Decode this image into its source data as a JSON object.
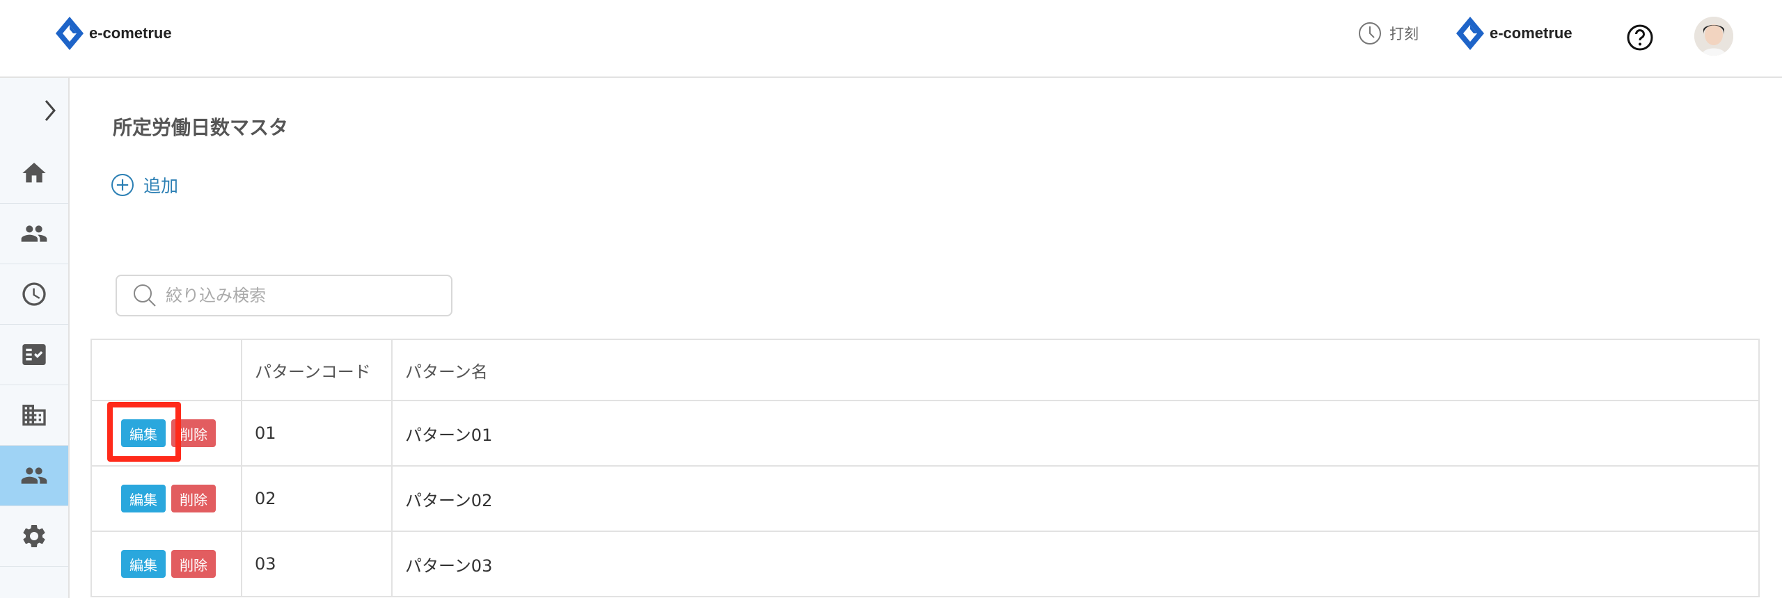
{
  "header": {
    "logo_text": "e-cometrue",
    "stamp_label": "打刻",
    "company_logo_text": "e-cometrue"
  },
  "sidebar": {
    "items": [
      {
        "icon": "home-icon"
      },
      {
        "icon": "people-icon"
      },
      {
        "icon": "clock-icon"
      },
      {
        "icon": "checklist-icon"
      },
      {
        "icon": "building-icon"
      },
      {
        "icon": "people-icon",
        "active": true
      },
      {
        "icon": "gear-icon"
      }
    ]
  },
  "main": {
    "title": "所定労働日数マスタ",
    "add_label": "追加",
    "search_placeholder": "絞り込み検索"
  },
  "table": {
    "columns": [
      "",
      "パターンコード",
      "パターン名"
    ],
    "edit_label": "編集",
    "delete_label": "削除",
    "rows": [
      {
        "code": "01",
        "name": "パターン01"
      },
      {
        "code": "02",
        "name": "パターン02"
      },
      {
        "code": "03",
        "name": "パターン03"
      }
    ]
  },
  "colors": {
    "accent": "#2b7fb4",
    "edit": "#2aa7dd",
    "delete": "#e25d60",
    "sidebar_active": "#9fd3f5",
    "highlight": "#ff2a1a"
  }
}
